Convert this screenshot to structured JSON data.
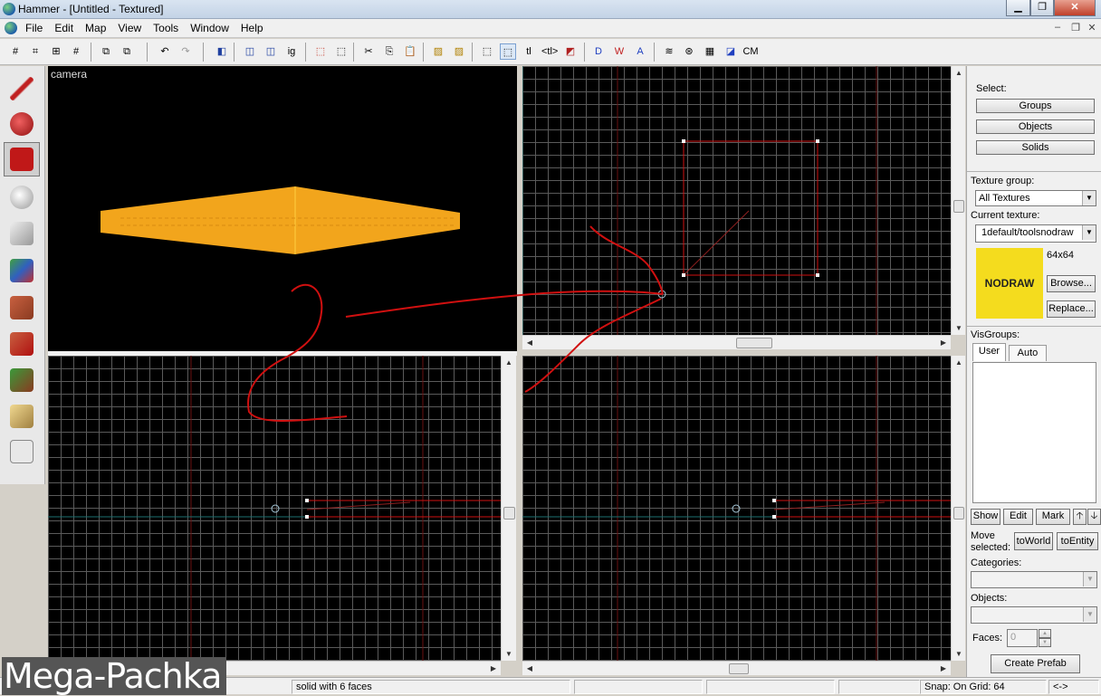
{
  "window": {
    "title": "Hammer - [Untitled - Textured]",
    "minimize": "▁",
    "maximize": "❐",
    "close": "✕"
  },
  "menu": {
    "items": [
      "File",
      "Edit",
      "Map",
      "View",
      "Tools",
      "Window",
      "Help"
    ],
    "mdi_min": "–",
    "mdi_restore": "❐",
    "mdi_close": "✕"
  },
  "toolbar": {
    "ig_label": "ig",
    "tl_label": "tl",
    "tl2_label": "<tl>",
    "cm_label": "CM"
  },
  "viewports": {
    "camera_label": "camera"
  },
  "right_panel": {
    "select_label": "Select:",
    "groups": "Groups",
    "objects": "Objects",
    "solids": "Solids",
    "texture_group_label": "Texture group:",
    "texture_group_value": "All Textures",
    "current_texture_label": "Current texture:",
    "current_texture_value": "1default/toolsnodraw",
    "texture_size": "64x64",
    "texture_preview_text": "NODRAW",
    "browse": "Browse...",
    "replace": "Replace...",
    "visgroups_label": "VisGroups:",
    "tab_user": "User",
    "tab_auto": "Auto",
    "show": "Show",
    "edit": "Edit",
    "mark": "Mark",
    "up": "🡡",
    "down": "🡣",
    "move_selected_line1": "Move",
    "move_selected_line2": "selected:",
    "to_world": "toWorld",
    "to_entity": "toEntity",
    "categories_label": "Categories:",
    "objects_label": "Objects:",
    "faces_label": "Faces:",
    "faces_value": "0",
    "create_prefab": "Create Prefab"
  },
  "status": {
    "selection": "solid with 6 faces",
    "snap": "Snap: On Grid: 64",
    "nav": "<->"
  },
  "watermark": "Mega-Pachka",
  "colors": {
    "grid_line": "#5a5a5a",
    "selection_red": "#d01010",
    "axis_red": "#6a1010",
    "axis_cyan": "#1c6f6f",
    "texture_yellow": "#f4dc1e",
    "brush_orange": "#f2a51c"
  }
}
